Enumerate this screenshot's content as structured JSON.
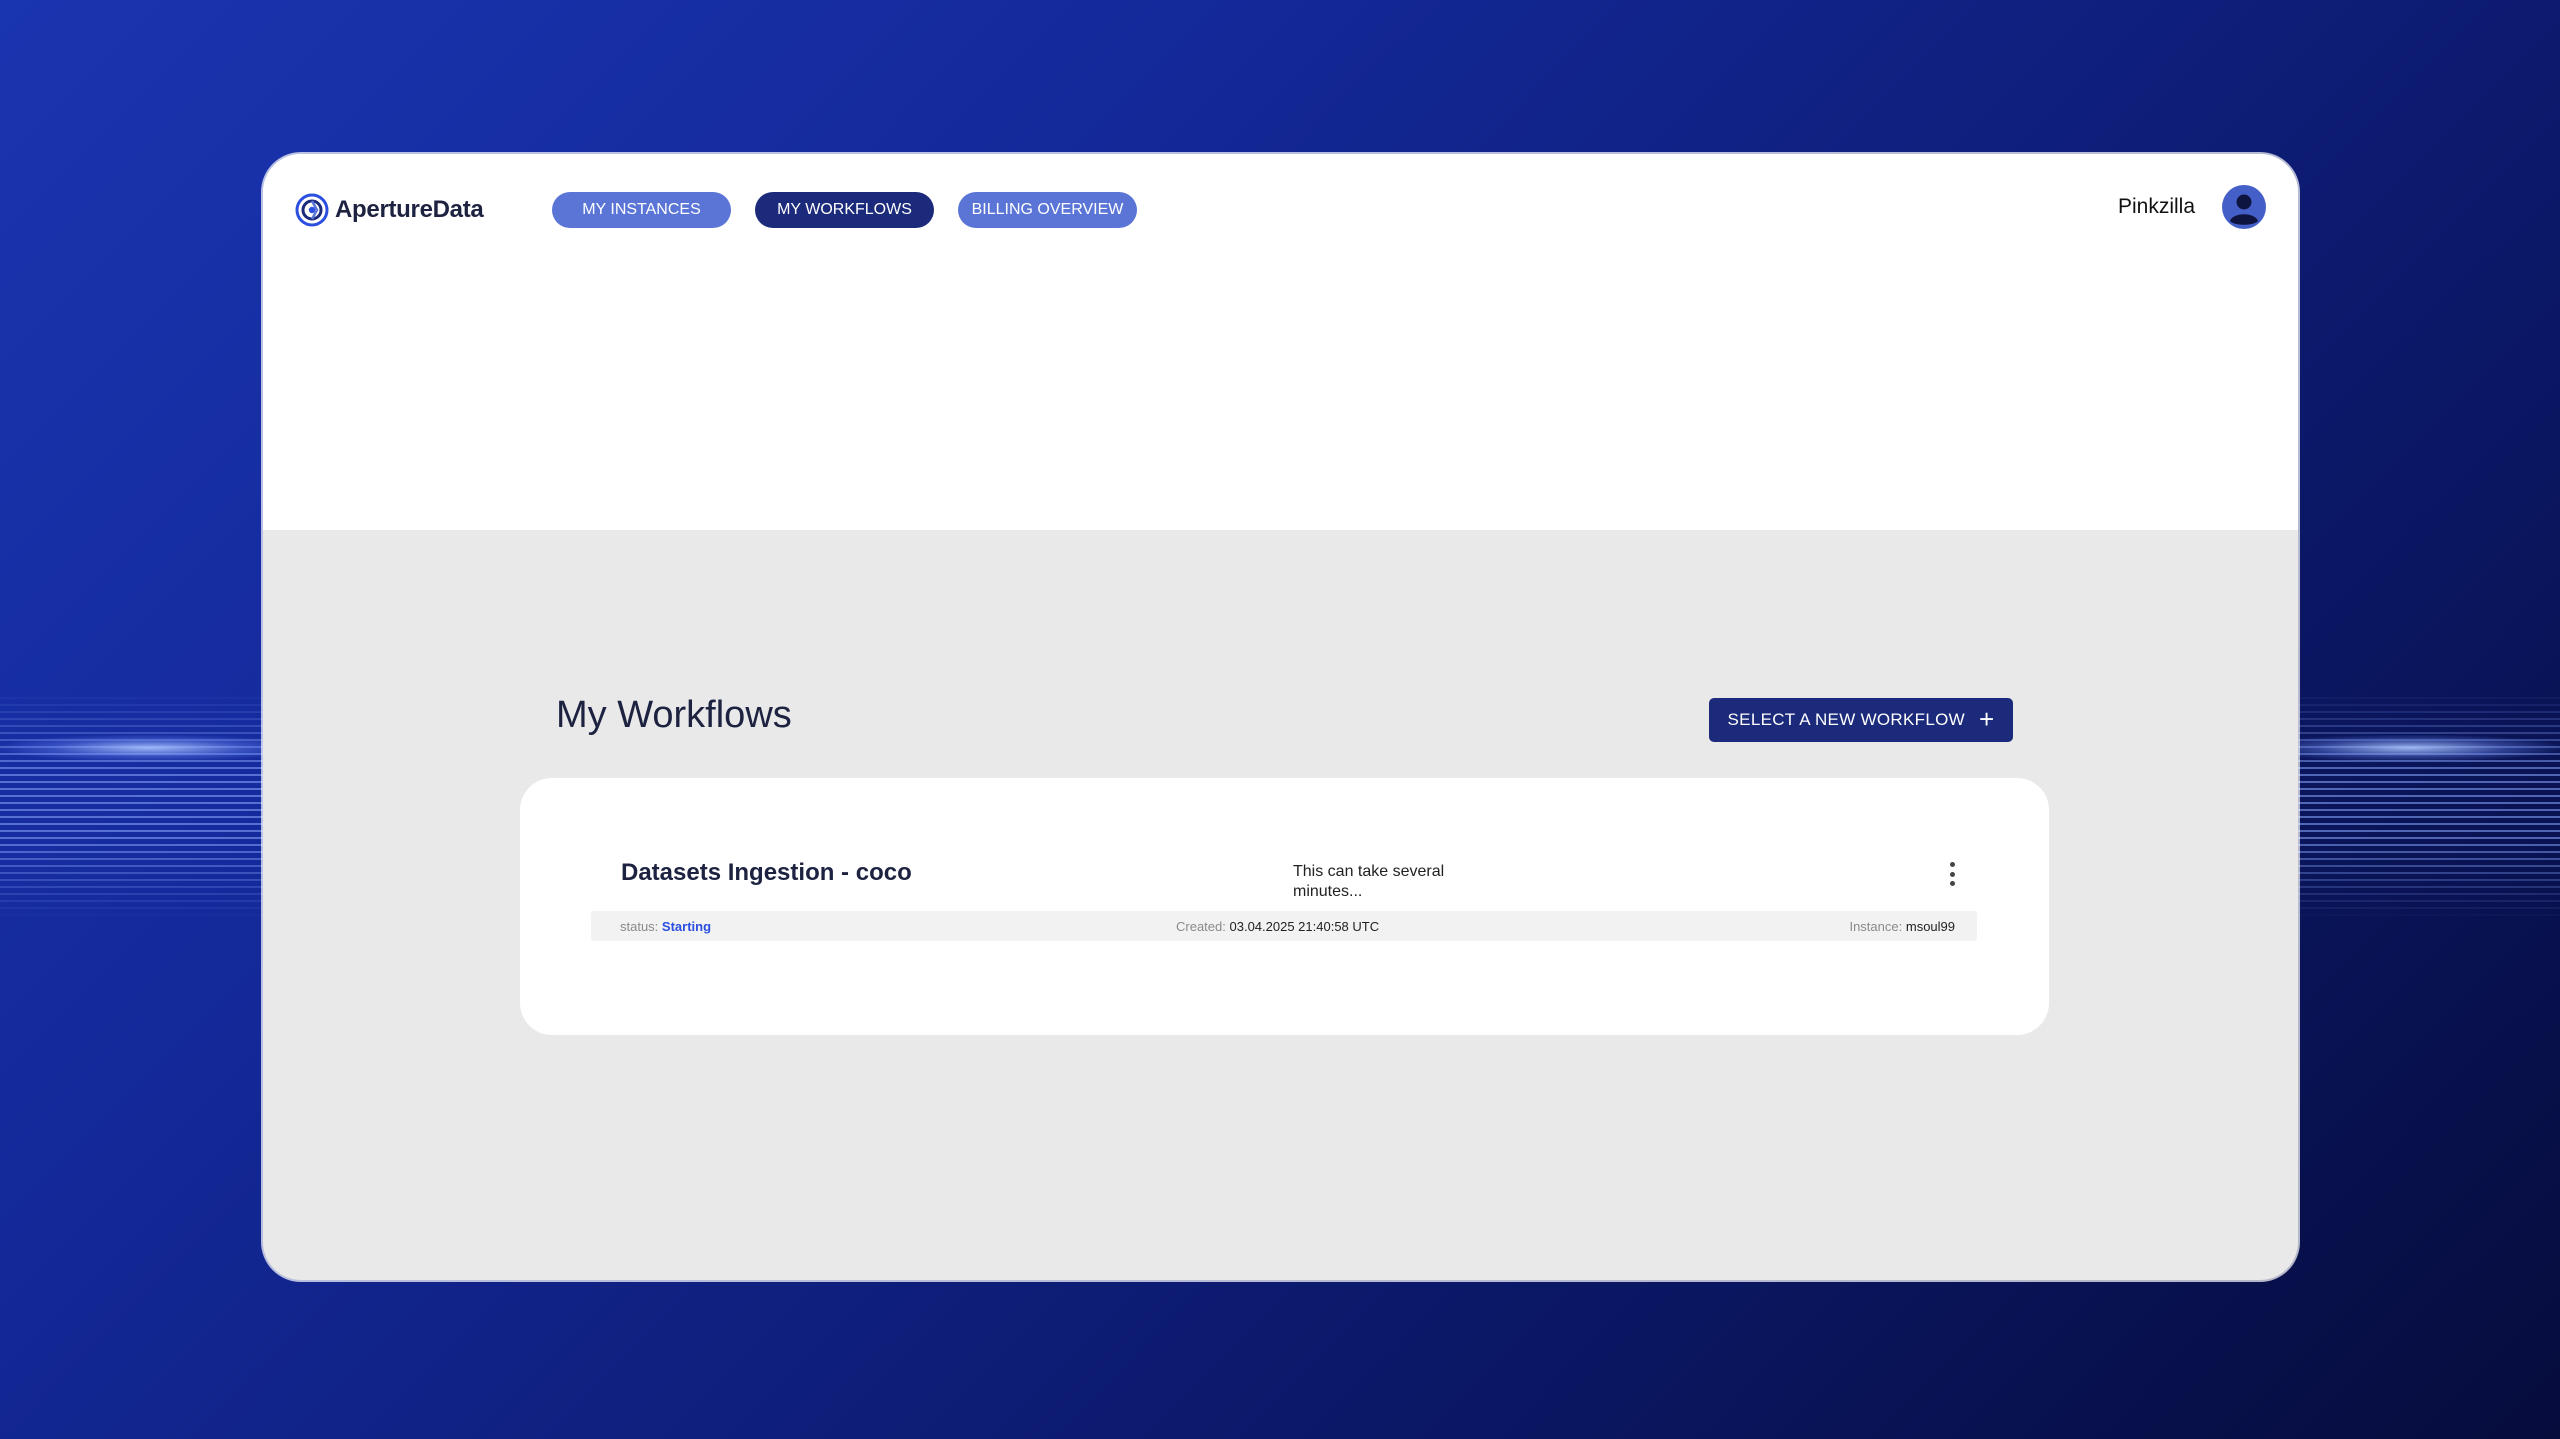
{
  "brand": {
    "name": "ApertureData",
    "logo_icon": "aperture-logo-icon"
  },
  "nav": {
    "my_instances": "MY INSTANCES",
    "my_workflows": "MY WORKFLOWS",
    "billing_overview": "BILLING OVERVIEW",
    "active": "MY WORKFLOWS"
  },
  "user": {
    "name": "Pinkzilla",
    "avatar_icon": "user-avatar-icon"
  },
  "page": {
    "title": "My Workflows",
    "new_button_label": "SELECT A NEW WORKFLOW",
    "new_button_icon": "plus-icon"
  },
  "workflows": [
    {
      "title": "Datasets Ingestion - coco",
      "note": "This can take several minutes...",
      "status_label": "status:",
      "status": "Starting",
      "created_label": "Created:",
      "created": "03.04.2025 21:40:58 UTC",
      "instance_label": "Instance:",
      "instance": "msoul99"
    }
  ],
  "colors": {
    "primary_dark": "#1b2a7a",
    "primary_light": "#5a75d6",
    "status_blue": "#2b4fe0",
    "page_bg": "#e9e9e9"
  }
}
